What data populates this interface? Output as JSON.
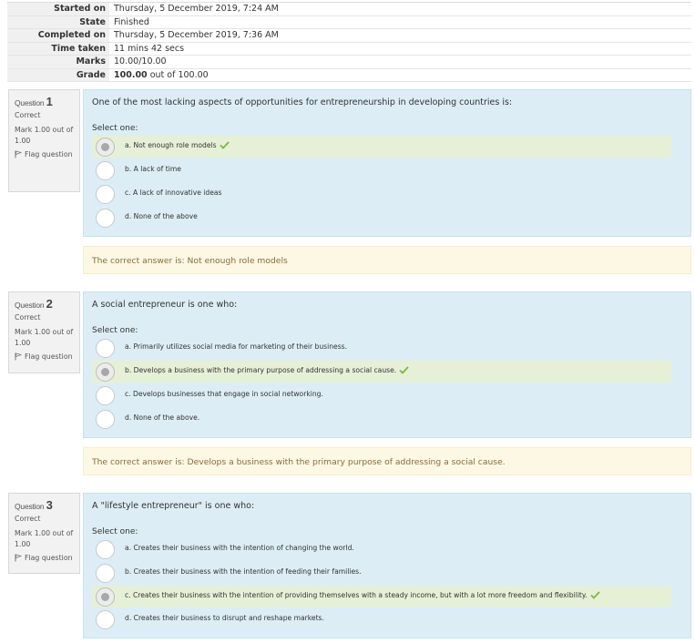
{
  "summary": [
    {
      "label": "Started on",
      "value": "Thursday, 5 December 2019, 7:24 AM"
    },
    {
      "label": "State",
      "value": "Finished"
    },
    {
      "label": "Completed on",
      "value": "Thursday, 5 December 2019, 7:36 AM"
    },
    {
      "label": "Time taken",
      "value": "11 mins 42 secs"
    },
    {
      "label": "Marks",
      "value": "10.00/10.00"
    },
    {
      "label": "Grade",
      "value_strong": "100.00",
      "value_rest": " out of 100.00"
    }
  ],
  "questions": [
    {
      "label_word": "Question",
      "number": "1",
      "state": "Correct",
      "mark": "Mark 1.00 out of 1.00",
      "flag": "Flag question",
      "text": "One of the most lacking aspects of opportunities for entrepreneurship in developing countries is:",
      "prompt": "Select one:",
      "options": [
        "a. Not enough role models",
        "b. A lack of time",
        "c. A lack of innovative ideas",
        "d. None of the above"
      ],
      "selected": 0,
      "feedback": "The correct answer is: Not enough role models"
    },
    {
      "label_word": "Question",
      "number": "2",
      "state": "Correct",
      "mark": "Mark 1.00 out of 1.00",
      "flag": "Flag question",
      "text": "A social entrepreneur is one who:",
      "prompt": "Select one:",
      "options": [
        "a. Primarily utilizes social media for marketing of their business.",
        "b. Develops a business with the primary purpose of addressing a social cause.",
        "c. Develops businesses that engage in social networking.",
        "d. None of the above."
      ],
      "selected": 1,
      "feedback": "The correct answer is: Develops a business with the primary purpose of addressing a social cause."
    },
    {
      "label_word": "Question",
      "number": "3",
      "state": "Correct",
      "mark": "Mark 1.00 out of 1.00",
      "flag": "Flag question",
      "text": "A \"lifestyle entrepreneur\" is one who:",
      "prompt": "Select one:",
      "options": [
        "a. Creates their business with the intention of changing the world.",
        "b. Creates their business with the intention of feeding their families.",
        "c. Creates their business with the intention of providing themselves with a steady income, but with a lot more freedom and flexibility.",
        "d. Creates their business to disrupt and reshape markets."
      ],
      "selected": 2
    }
  ],
  "icons": {
    "flag": "flag-icon",
    "correct": "checkmark-icon"
  },
  "colors": {
    "content_bg": "#dcedf5",
    "correct_bg": "#e6f0d6",
    "feedback_bg": "#fcf8e4",
    "feedback_text": "#8a6d3b",
    "tick": "#7ab648"
  }
}
